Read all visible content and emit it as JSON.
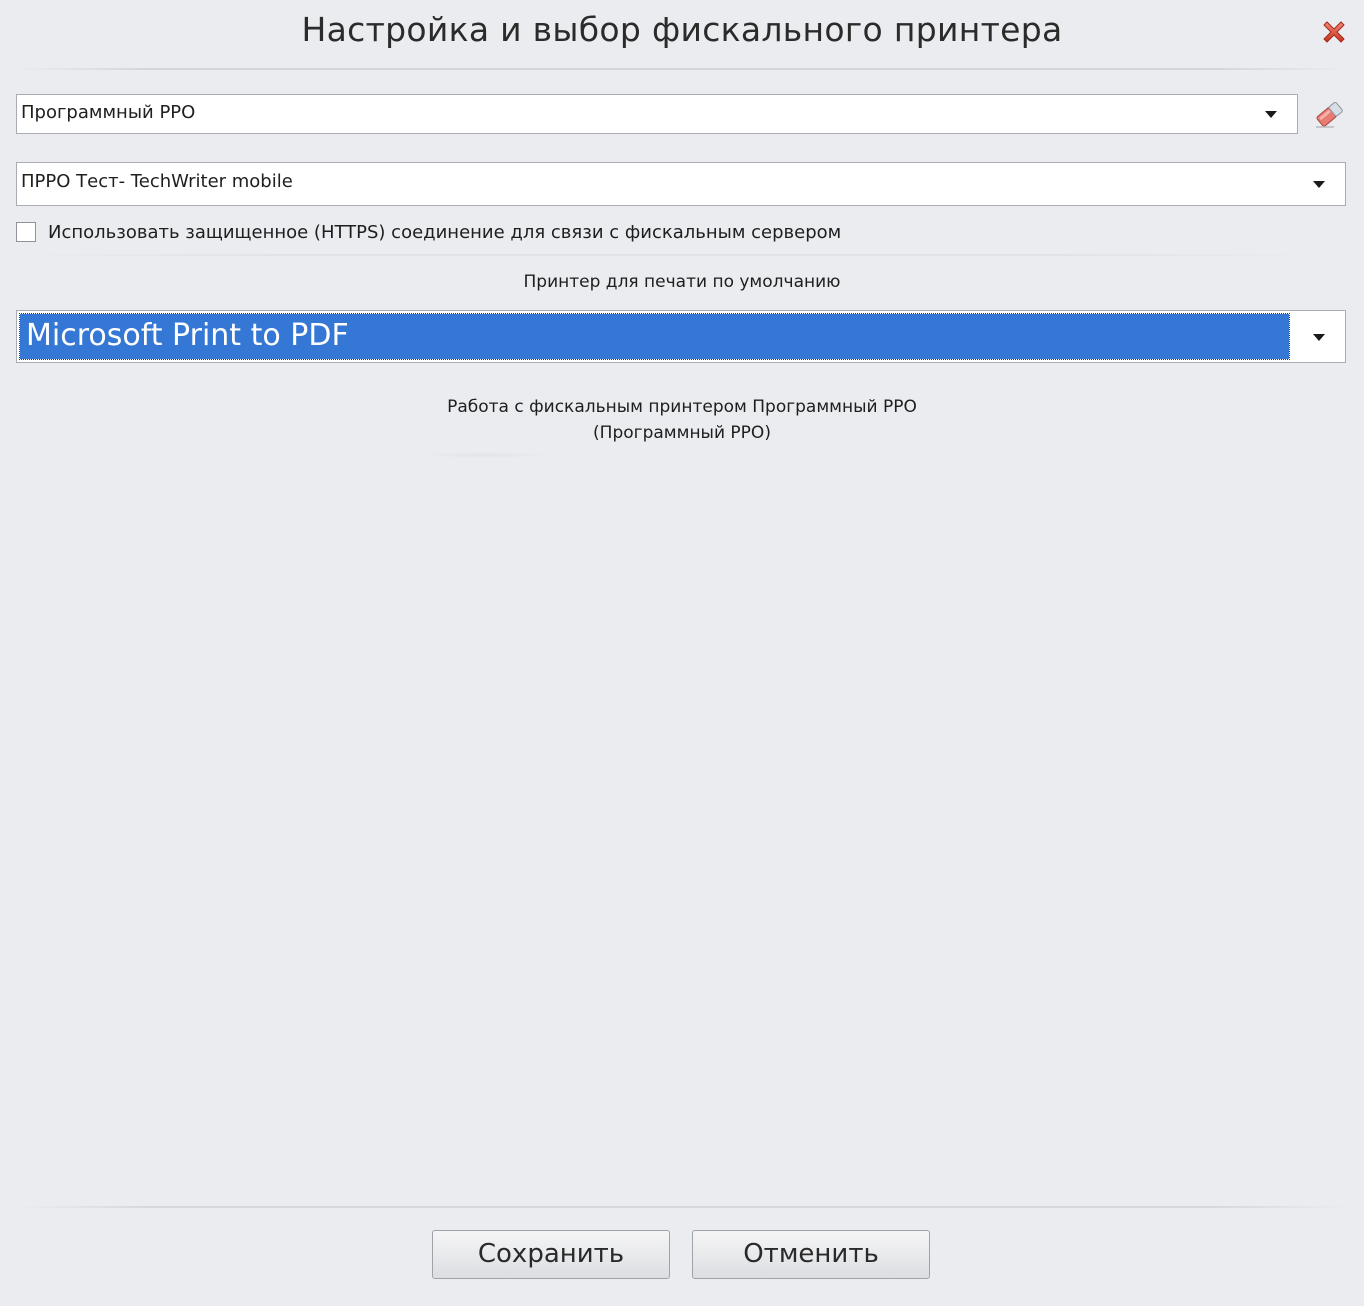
{
  "dialog": {
    "title": "Настройка и выбор фискального принтера"
  },
  "device_type": {
    "selected": "Программный РРО"
  },
  "cashier": {
    "selected": "ПРРО Тест- TechWriter mobile"
  },
  "https_option": {
    "label": "Использовать защищенное (HTTPS) соединение для связи с фискальным сервером",
    "checked": false
  },
  "default_printer": {
    "label": "Принтер для печати по умолчанию",
    "selected": "Microsoft Print to PDF"
  },
  "info": {
    "line1": "Работа с фискальным принтером Программный РРО",
    "line2": "(Программный РРО)"
  },
  "footer": {
    "save_label": "Сохранить",
    "cancel_label": "Отменить"
  },
  "colors": {
    "selection": "#3477d4",
    "close_icon": "#e04a3c",
    "background": "#ebecef"
  },
  "icons": {
    "close": "close-icon",
    "edit": "eraser-icon",
    "dropdown": "chevron-down-icon"
  }
}
